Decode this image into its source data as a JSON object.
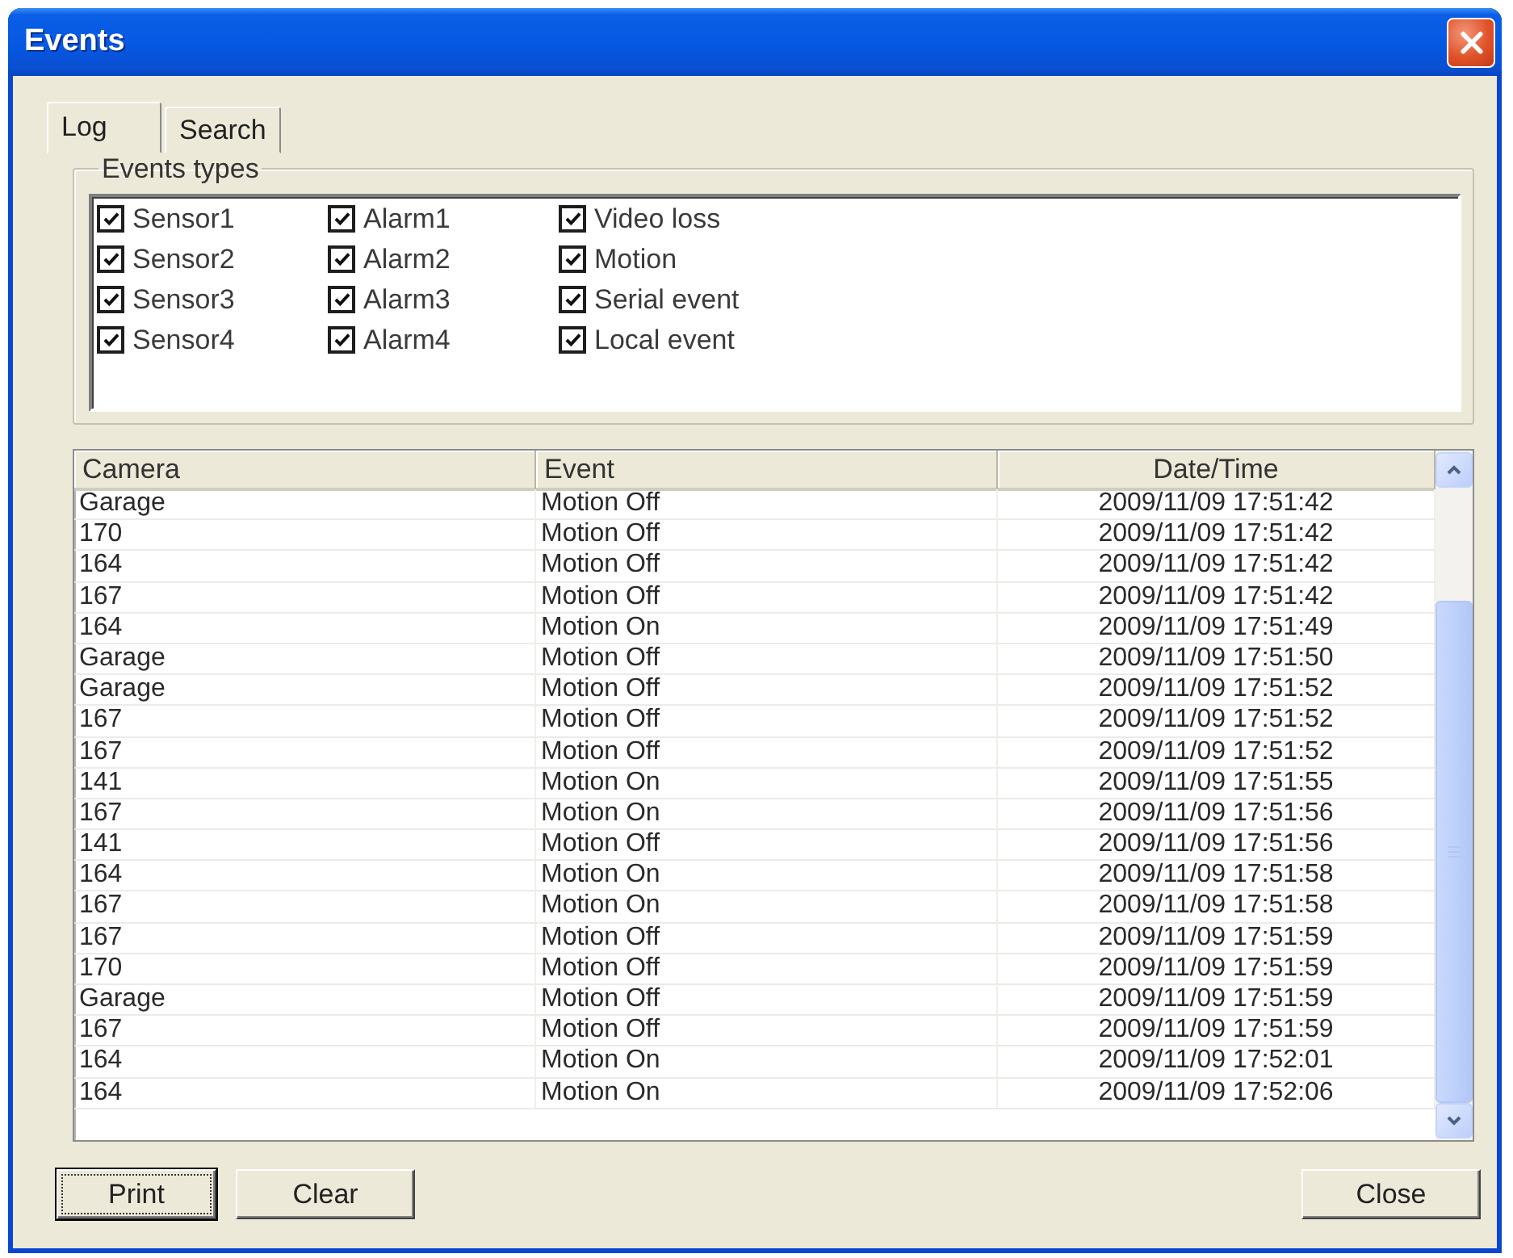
{
  "window": {
    "title": "Events"
  },
  "tabs": [
    {
      "label": "Log",
      "selected": true
    },
    {
      "label": "Search",
      "selected": false
    }
  ],
  "event_types": {
    "label": "Events types",
    "items": [
      {
        "label": "Sensor1",
        "checked": true
      },
      {
        "label": "Sensor2",
        "checked": true
      },
      {
        "label": "Sensor3",
        "checked": true
      },
      {
        "label": "Sensor4",
        "checked": true
      },
      {
        "label": "Alarm1",
        "checked": true
      },
      {
        "label": "Alarm2",
        "checked": true
      },
      {
        "label": "Alarm3",
        "checked": true
      },
      {
        "label": "Alarm4",
        "checked": true
      },
      {
        "label": "Video loss",
        "checked": true
      },
      {
        "label": "Motion",
        "checked": true
      },
      {
        "label": "Serial event",
        "checked": true
      },
      {
        "label": "Local event",
        "checked": true
      }
    ]
  },
  "event_log": {
    "columns": [
      "Camera",
      "Event",
      "Date/Time"
    ],
    "rows": [
      [
        "Garage",
        "Motion Off",
        "2009/11/09 17:51:42"
      ],
      [
        "170",
        "Motion Off",
        "2009/11/09 17:51:42"
      ],
      [
        "164",
        "Motion Off",
        "2009/11/09 17:51:42"
      ],
      [
        "167",
        "Motion Off",
        "2009/11/09 17:51:42"
      ],
      [
        "164",
        "Motion On",
        "2009/11/09 17:51:49"
      ],
      [
        "Garage",
        "Motion Off",
        "2009/11/09 17:51:50"
      ],
      [
        "Garage",
        "Motion Off",
        "2009/11/09 17:51:52"
      ],
      [
        "167",
        "Motion Off",
        "2009/11/09 17:51:52"
      ],
      [
        "167",
        "Motion Off",
        "2009/11/09 17:51:52"
      ],
      [
        "141",
        "Motion On",
        "2009/11/09 17:51:55"
      ],
      [
        "167",
        "Motion On",
        "2009/11/09 17:51:56"
      ],
      [
        "141",
        "Motion Off",
        "2009/11/09 17:51:56"
      ],
      [
        "164",
        "Motion On",
        "2009/11/09 17:51:58"
      ],
      [
        "167",
        "Motion On",
        "2009/11/09 17:51:58"
      ],
      [
        "167",
        "Motion Off",
        "2009/11/09 17:51:59"
      ],
      [
        "170",
        "Motion Off",
        "2009/11/09 17:51:59"
      ],
      [
        "Garage",
        "Motion Off",
        "2009/11/09 17:51:59"
      ],
      [
        "167",
        "Motion Off",
        "2009/11/09 17:51:59"
      ],
      [
        "164",
        "Motion On",
        "2009/11/09 17:52:01"
      ],
      [
        "164",
        "Motion On",
        "2009/11/09 17:52:06"
      ]
    ]
  },
  "buttons": [
    {
      "label": "Print",
      "default": true
    },
    {
      "label": "Clear",
      "default": false
    },
    {
      "label": "Close",
      "default": false
    }
  ]
}
